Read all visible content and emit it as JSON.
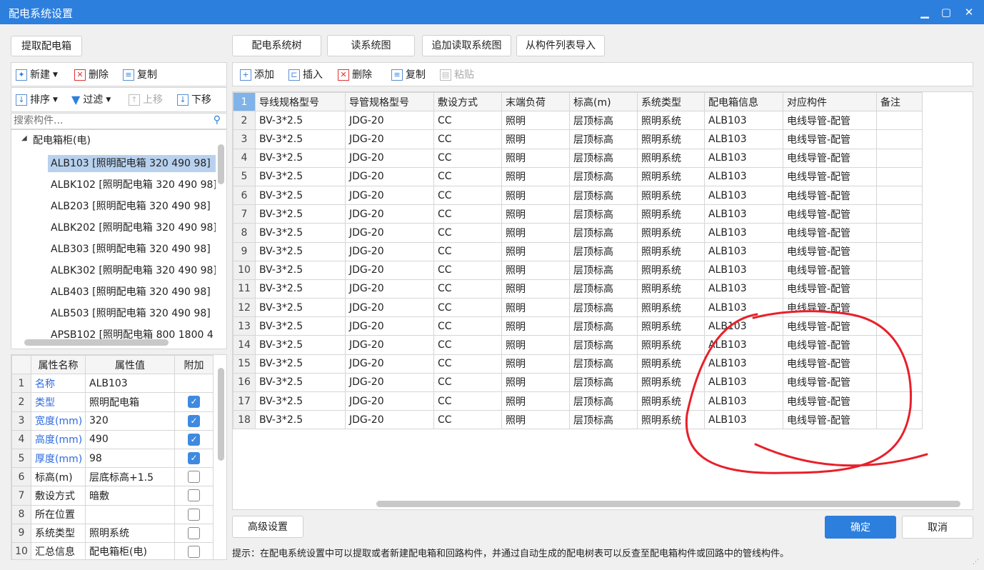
{
  "window": {
    "title": "配电系统设置",
    "minimize": "▁",
    "maximize": "▢",
    "close": "✕"
  },
  "left": {
    "extract_button": "提取配电箱",
    "toolbar1": {
      "new": "新建",
      "delete": "删除",
      "copy": "复制"
    },
    "toolbar2": {
      "sort": "排序",
      "filter": "过滤",
      "move_up": "上移",
      "move_down": "下移"
    },
    "search_placeholder": "搜索构件...",
    "tree": {
      "root": "配电箱柜(电)",
      "items": [
        "ALB103 [照明配电箱 320 490 98]",
        "ALBK102 [照明配电箱 320 490 98]",
        "ALB203 [照明配电箱 320 490 98]",
        "ALBK202 [照明配电箱 320 490 98]",
        "ALB303 [照明配电箱 320 490 98]",
        "ALBK302 [照明配电箱 320 490 98]",
        "ALB403 [照明配电箱 320 490 98]",
        "ALB503 [照明配电箱 320 490 98]",
        "APSB102 [照明配电箱 800 1800 4"
      ]
    },
    "props": {
      "headers": [
        "属性名称",
        "属性值",
        "附加"
      ],
      "rows": [
        {
          "n": "1",
          "name": "名称",
          "value": "ALB103",
          "blue": true,
          "check": null
        },
        {
          "n": "2",
          "name": "类型",
          "value": "照明配电箱",
          "blue": true,
          "check": true
        },
        {
          "n": "3",
          "name": "宽度(mm)",
          "value": "320",
          "blue": true,
          "check": true
        },
        {
          "n": "4",
          "name": "高度(mm)",
          "value": "490",
          "blue": true,
          "check": true
        },
        {
          "n": "5",
          "name": "厚度(mm)",
          "value": "98",
          "blue": true,
          "check": true
        },
        {
          "n": "6",
          "name": "标高(m)",
          "value": "层底标高+1.5",
          "blue": false,
          "check": false
        },
        {
          "n": "7",
          "name": "敷设方式",
          "value": "暗敷",
          "blue": false,
          "check": false
        },
        {
          "n": "8",
          "name": "所在位置",
          "value": "",
          "blue": false,
          "check": false
        },
        {
          "n": "9",
          "name": "系统类型",
          "value": "照明系统",
          "blue": false,
          "check": false
        },
        {
          "n": "10",
          "name": "汇总信息",
          "value": "配电箱柜(电)",
          "blue": false,
          "check": false
        }
      ]
    }
  },
  "right": {
    "buttons": [
      "配电系统树",
      "读系统图",
      "追加读取系统图",
      "从构件列表导入"
    ],
    "toolbar": {
      "add": "添加",
      "insert": "插入",
      "delete": "删除",
      "copy": "复制",
      "paste": "粘贴"
    },
    "grid": {
      "header_row": "1",
      "headers": [
        "导线规格型号",
        "导管规格型号",
        "敷设方式",
        "末端负荷",
        "标高(m)",
        "系统类型",
        "配电箱信息",
        "对应构件",
        "备注"
      ],
      "row_numbers": [
        "2",
        "3",
        "4",
        "5",
        "6",
        "7",
        "8",
        "9",
        "10",
        "11",
        "12",
        "13",
        "14",
        "15",
        "16",
        "17",
        "18"
      ],
      "row_values": [
        "BV-3*2.5",
        "JDG-20",
        "CC",
        "照明",
        "层顶标高",
        "照明系统",
        "ALB103",
        "电线导管-配管",
        ""
      ]
    },
    "advanced_button": "高级设置",
    "ok_button": "确定",
    "cancel_button": "取消",
    "hint": "提示：在配电系统设置中可以提取或者新建配电箱和回路构件，并通过自动生成的配电树表可以反查至配电箱构件或回路中的管线构件。"
  },
  "colors": {
    "accent": "#2d7fdd",
    "annotation": "#e8202a"
  }
}
